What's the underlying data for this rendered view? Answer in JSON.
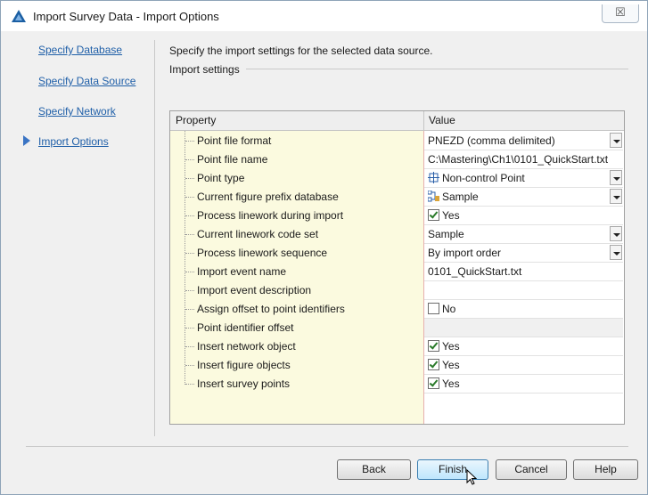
{
  "window": {
    "title": "Import Survey Data - Import Options",
    "close_glyph": "☒"
  },
  "nav": {
    "items": [
      {
        "label": "Specify Database"
      },
      {
        "label": "Specify Data Source"
      },
      {
        "label": "Specify Network"
      },
      {
        "label": "Import Options"
      }
    ],
    "active_index": 3
  },
  "content": {
    "description": "Specify the import settings for the selected data source.",
    "group_label": "Import settings"
  },
  "grid": {
    "header_property": "Property",
    "header_value": "Value",
    "rows": [
      {
        "label": "Point file format",
        "value": "PNEZD (comma delimited)",
        "kind": "dropdown"
      },
      {
        "label": "Point file name",
        "value": "C:\\Mastering\\Ch1\\0101_QuickStart.txt",
        "kind": "text"
      },
      {
        "label": "Point type",
        "value": "Non-control Point",
        "kind": "dropdown-icon",
        "icon": "point-type-icon"
      },
      {
        "label": "Current figure prefix database",
        "value": "Sample",
        "kind": "dropdown-icon",
        "icon": "figure-prefix-db-icon"
      },
      {
        "label": "Process linework during import",
        "value": "Yes",
        "kind": "checkbox",
        "checked": true
      },
      {
        "label": "Current linework code set",
        "value": "Sample",
        "kind": "dropdown"
      },
      {
        "label": "Process linework sequence",
        "value": "By import order",
        "kind": "dropdown"
      },
      {
        "label": "Import event name",
        "value": "0101_QuickStart.txt",
        "kind": "text"
      },
      {
        "label": "Import event description",
        "value": "",
        "kind": "text"
      },
      {
        "label": "Assign offset to point identifiers",
        "value": "No",
        "kind": "checkbox",
        "checked": false
      },
      {
        "label": "Point identifier offset",
        "value": "",
        "kind": "disabled"
      },
      {
        "label": "Insert network object",
        "value": "Yes",
        "kind": "checkbox",
        "checked": true
      },
      {
        "label": "Insert figure objects",
        "value": "Yes",
        "kind": "checkbox",
        "checked": true
      },
      {
        "label": "Insert survey points",
        "value": "Yes",
        "kind": "checkbox",
        "checked": true
      }
    ]
  },
  "buttons": {
    "back": "Back",
    "finish": "Finish",
    "cancel": "Cancel",
    "help": "Help"
  },
  "colors": {
    "link": "#1f5fa8",
    "property_column_bg": "#fbfadf",
    "primary_button": "#bee6fd"
  }
}
